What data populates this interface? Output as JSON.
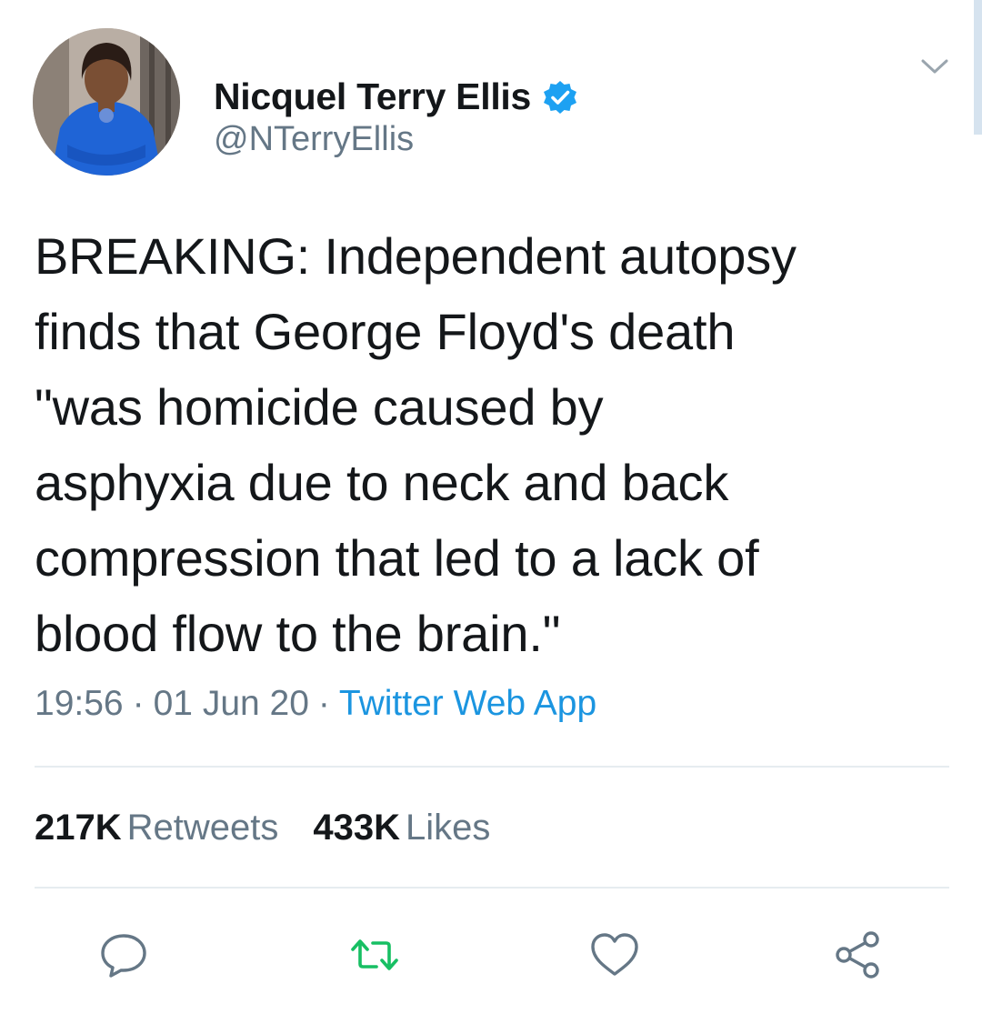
{
  "user": {
    "display_name": "Nicquel Terry Ellis",
    "handle": "@NTerryEllis",
    "verified_icon": "verified-badge-icon",
    "avatar": "profile-photo"
  },
  "tweet": {
    "text": "BREAKING: Independent autopsy\nfinds that George Floyd's death\n\"was homicide caused by\nasphyxia due to neck and back\ncompression that led to a lack of\nblood flow to the brain.\""
  },
  "meta": {
    "time": "19:56",
    "separator": "·",
    "date": "01 Jun 20",
    "source": "Twitter Web App"
  },
  "stats": {
    "retweets_count": "217K",
    "retweets_label": "Retweets",
    "likes_count": "433K",
    "likes_label": "Likes"
  },
  "actions": {
    "reply_icon": "reply-icon",
    "retweet_icon": "retweet-icon",
    "like_icon": "heart-icon",
    "share_icon": "share-icon"
  },
  "colors": {
    "accent": "#1b95e0",
    "muted": "#657786",
    "retweet_green": "#17bf63",
    "divider": "#e6ecf0"
  }
}
